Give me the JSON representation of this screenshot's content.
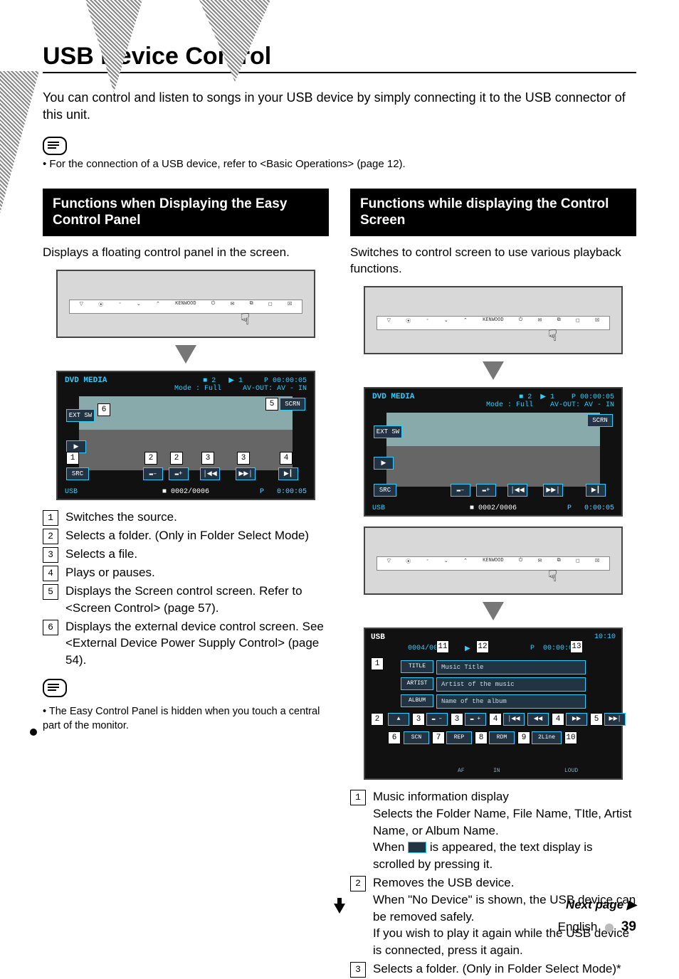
{
  "title": "USB Device Control",
  "intro": "You can control and listen to songs in your USB device by simply connecting it to the USB connector of this unit.",
  "top_note": "For the connection of a USB device, refer to <Basic Operations> (page 12).",
  "left": {
    "heading": "Functions when Displaying the Easy Control Panel",
    "lead": "Displays a floating control panel in the screen.",
    "topbar_items": [
      "▽",
      "⦿",
      "◦",
      "⌄",
      "⌃",
      "KENWOOD",
      "⏻",
      "✉",
      "⧉",
      "◻",
      "☒"
    ],
    "dvd": {
      "title": "DVD MEDIA",
      "status_a": "■ 2",
      "status_b": "▶ 1",
      "time": "P  00:00:05",
      "mode": "Mode : Full",
      "avout": "AV-OUT: AV - IN",
      "scrn": "SCRN",
      "ext_sw": "EXT SW",
      "src": "SRC",
      "usb": "USB",
      "counter": "■ 0002/0006",
      "p": "P",
      "elapsed": "0:00:05"
    },
    "callouts": [
      "Switches the source.",
      "Selects a folder. (Only in Folder Select Mode)",
      "Selects a file.",
      "Plays or pauses.",
      "Displays the Screen control screen. Refer to <Screen Control> (page 57).",
      "Displays the external device control screen. See <External Device Power Supply Control> (page 54)."
    ],
    "subnote": "The Easy Control Panel is hidden when you touch a central part of the monitor."
  },
  "right": {
    "heading": "Functions while displaying the Control Screen",
    "lead": "Switches to control screen to use various playback functions.",
    "usb": {
      "title": "USB",
      "clock": "10:10",
      "counter": "0004/0006",
      "play_cursor": "▶",
      "p_label": "P",
      "elapsed": "00:00:05",
      "rows": [
        {
          "label": "TITLE",
          "value": "Music Title"
        },
        {
          "label": "ARTIST",
          "value": "Artist of the music"
        },
        {
          "label": "ALBUM",
          "value": "Name of the album"
        }
      ],
      "buttons_row1": [
        "▲",
        "▬ –",
        "▬ +",
        "│◀◀",
        "◀◀",
        "▶▶",
        "▶▶│",
        "▶│"
      ],
      "buttons_row2": [
        "SCN",
        "REP",
        "RDM",
        "2Line"
      ],
      "footer_labels": [
        "AF",
        "IN",
        "LOUD"
      ]
    },
    "callouts": [
      {
        "n": "1",
        "lines": [
          "Music information display",
          "Selects the Folder Name, File Name, TItle, Artist Name, or Album Name.",
          "When __BTN__ is appeared, the text display is scrolled by pressing it."
        ]
      },
      {
        "n": "2",
        "lines": [
          "Removes the USB device.",
          "When \"No Device\" is shown, the USB device can be removed safely.",
          "If you wish to play it again while the USB device is connected, press it again."
        ]
      },
      {
        "n": "3",
        "lines": [
          "Selects a folder. (Only in Folder Select Mode)*"
        ]
      }
    ]
  },
  "next_page": "Next page ▶",
  "lang": "English",
  "page_num": "39"
}
